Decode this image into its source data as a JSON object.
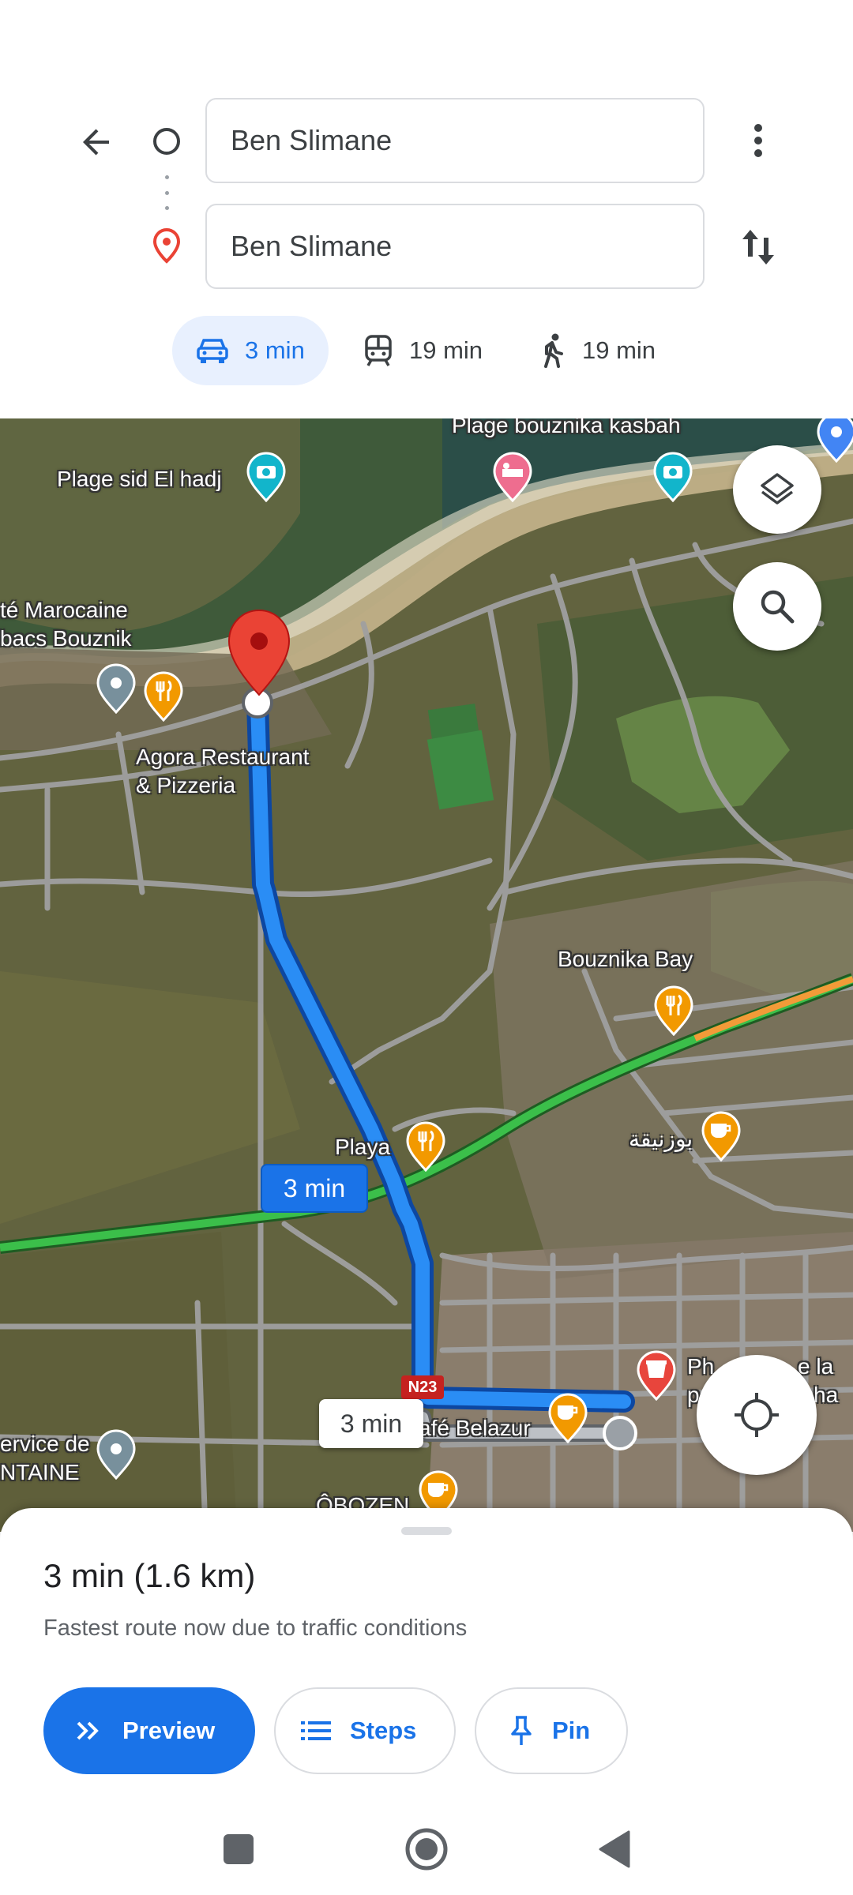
{
  "directions": {
    "origin_value": "Ben Slimane",
    "destination_value": "Ben Slimane",
    "back_icon": "arrow-back-icon",
    "more_icon": "more-vert-icon",
    "swap_icon": "swap-vert-icon"
  },
  "travel_modes": [
    {
      "icon": "car-icon",
      "label": "3 min",
      "selected": true
    },
    {
      "icon": "transit-icon",
      "label": "19 min",
      "selected": false
    },
    {
      "icon": "walk-icon",
      "label": "19 min",
      "selected": false
    }
  ],
  "map": {
    "labels": {
      "plage_sid": "Plage sid El hadj",
      "plage_kasbah": "Plage bouznika kasbah",
      "marocaine": "té Marocaine",
      "bacs": "bacs Bouznik",
      "agora_1": "Agora Restaurant",
      "agora_2": "& Pizzeria",
      "bouznika_bay": "Bouznika Bay",
      "playa": "Playa",
      "arabic": "بوزنيقة",
      "belazur": "afé Belazur",
      "service_1": "ervice de",
      "service_2": "NTAINE",
      "ozen": "ÔBOZEN",
      "pharmacie_1": "Ph",
      "pharmacie_2": "e la",
      "pharmacie_3": "p",
      "pharmacie_4": "ha",
      "road_shield": "N23"
    },
    "route_badge": "3 min",
    "alt_route_badge": "3 min",
    "layers_icon": "layers-icon",
    "search_icon": "search-icon",
    "location_icon": "my-location-icon",
    "colors": {
      "route": "#1a73e8",
      "alt_route": "#9aa0a6",
      "destination_pin": "#ea4335",
      "traffic_green": "#3bbf4a"
    }
  },
  "sheet": {
    "summary": "3 min (1.6 km)",
    "subtext": "Fastest route now due to traffic conditions",
    "buttons": {
      "preview": "Preview",
      "steps": "Steps",
      "pin": "Pin"
    }
  },
  "navbar": {
    "recents_icon": "square-icon",
    "home_icon": "circle-icon",
    "back_icon": "triangle-back-icon"
  }
}
